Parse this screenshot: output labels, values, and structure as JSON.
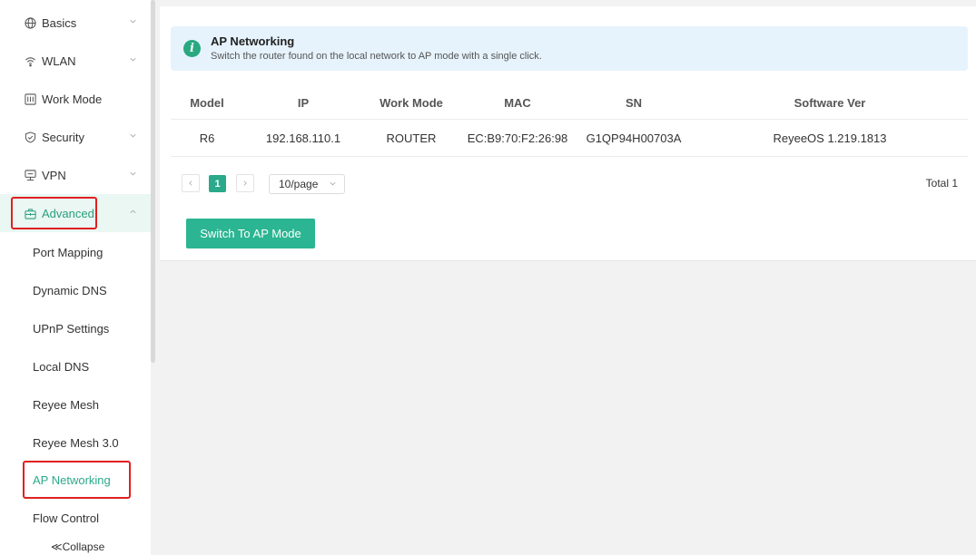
{
  "sidebar": {
    "items": [
      {
        "label": "Basics",
        "icon": "globe-icon",
        "has_chevron": true
      },
      {
        "label": "WLAN",
        "icon": "wifi-icon",
        "has_chevron": true
      },
      {
        "label": "Work Mode",
        "icon": "work-mode-icon",
        "has_chevron": false
      },
      {
        "label": "Security",
        "icon": "shield-icon",
        "has_chevron": true
      },
      {
        "label": "VPN",
        "icon": "vpn-icon",
        "has_chevron": true
      },
      {
        "label": "Advanced",
        "icon": "toolbox-icon",
        "has_chevron": true
      }
    ],
    "sub_items": [
      {
        "label": "Port Mapping"
      },
      {
        "label": "Dynamic DNS"
      },
      {
        "label": "UPnP Settings"
      },
      {
        "label": "Local DNS"
      },
      {
        "label": "Reyee Mesh"
      },
      {
        "label": "Reyee Mesh 3.0"
      },
      {
        "label": "AP Networking"
      },
      {
        "label": "Flow Control"
      }
    ],
    "collapse_label": "≪Collapse"
  },
  "info": {
    "title": "AP Networking",
    "description": "Switch the router found on the local network to AP mode with a single click."
  },
  "table": {
    "columns": [
      "Model",
      "IP",
      "Work Mode",
      "MAC",
      "SN",
      "Software Ver"
    ],
    "rows": [
      [
        "R6",
        "192.168.110.1",
        "ROUTER",
        "EC:B9:70:F2:26:98",
        "G1QP94H00703A",
        "ReyeeOS 1.219.1813"
      ]
    ]
  },
  "pagination": {
    "current_page": "1",
    "page_size": "10/page",
    "total": "Total 1"
  },
  "actions": {
    "switch_label": "Switch To AP Mode"
  },
  "colors": {
    "accent": "#2aaa8a",
    "highlight": "#e02020",
    "info_bg": "#e6f3fc"
  }
}
